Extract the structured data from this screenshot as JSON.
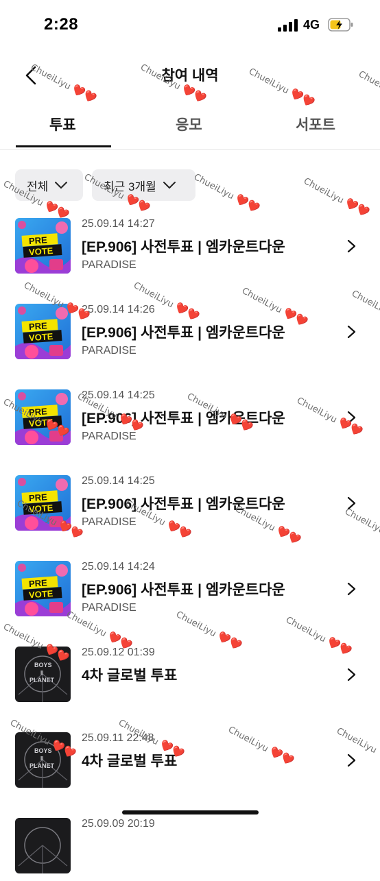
{
  "status_bar": {
    "time": "2:28",
    "network": "4G",
    "battery": "charging"
  },
  "header": {
    "title": "참여 내역",
    "back_icon": "chevron-left-icon"
  },
  "tabs": [
    {
      "label": "투표",
      "active": true
    },
    {
      "label": "응모",
      "active": false
    },
    {
      "label": "서포트",
      "active": false
    }
  ],
  "filters": [
    {
      "label": "전체",
      "icon": "chevron-down-icon"
    },
    {
      "label": "최근 3개월",
      "icon": "chevron-down-icon"
    }
  ],
  "items": [
    {
      "date": "25.09.14 14:27",
      "title": "[EP.906] 사전투표 | 엠카운트다운",
      "subtitle": "PARADISE",
      "thumb": "prevote",
      "thumb_text": [
        "PRE",
        "VOTE"
      ]
    },
    {
      "date": "25.09.14 14:26",
      "title": "[EP.906] 사전투표 | 엠카운트다운",
      "subtitle": "PARADISE",
      "thumb": "prevote",
      "thumb_text": [
        "PRE",
        "VOTE"
      ]
    },
    {
      "date": "25.09.14 14:25",
      "title": "[EP.906] 사전투표 | 엠카운트다운",
      "subtitle": "PARADISE",
      "thumb": "prevote",
      "thumb_text": [
        "PRE",
        "VOTE"
      ]
    },
    {
      "date": "25.09.14 14:25",
      "title": "[EP.906] 사전투표 | 엠카운트다운",
      "subtitle": "PARADISE",
      "thumb": "prevote",
      "thumb_text": [
        "PRE",
        "VOTE"
      ]
    },
    {
      "date": "25.09.14 14:24",
      "title": "[EP.906] 사전투표 | 엠카운트다운",
      "subtitle": "PARADISE",
      "thumb": "prevote",
      "thumb_text": [
        "PRE",
        "VOTE"
      ]
    },
    {
      "date": "25.09.12 01:39",
      "title": "4차 글로벌 투표",
      "subtitle": "",
      "thumb": "planet",
      "thumb_text": [
        "BOYS",
        "II",
        "PLANET"
      ]
    },
    {
      "date": "25.09.11 22:48",
      "title": "4차 글로벌 투표",
      "subtitle": "",
      "thumb": "planet",
      "thumb_text": [
        "BOYS",
        "II",
        "PLANET"
      ]
    },
    {
      "date": "25.09.09 20:19",
      "title": "",
      "subtitle": "",
      "thumb": "planet",
      "thumb_text": []
    }
  ],
  "watermark": {
    "text": "ChueiLiyu",
    "heart": "❤️❤️"
  },
  "colors": {
    "tab_active": "#111111",
    "chip_bg": "#eeeef0",
    "battery_fill": "#f5c518",
    "heart": "#d81b2a"
  }
}
